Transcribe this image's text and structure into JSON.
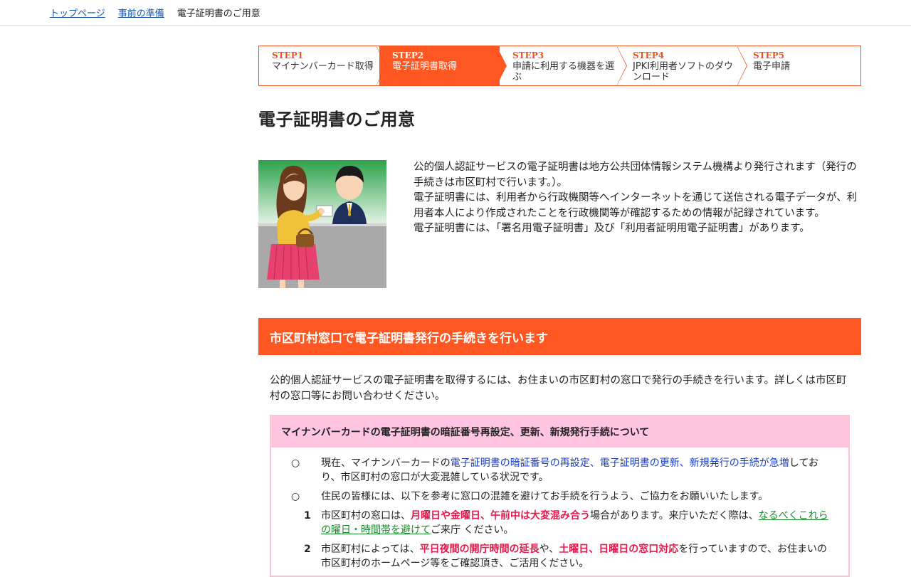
{
  "breadcrumb": {
    "home": "トップページ",
    "prep": "事前の準備",
    "current": "電子証明書のご用意"
  },
  "steps": [
    {
      "num": "STEP1",
      "label": "マイナンバーカード取得"
    },
    {
      "num": "STEP2",
      "label": "電子証明書取得"
    },
    {
      "num": "STEP3",
      "label": "申請に利用する機器を選ぶ"
    },
    {
      "num": "STEP4",
      "label": "JPKI利用者ソフトのダウンロード"
    },
    {
      "num": "STEP5",
      "label": "電子申請"
    }
  ],
  "active_step": 2,
  "title": "電子証明書のご用意",
  "intro": {
    "p1": "公的個人認証サービスの電子証明書は地方公共団体情報システム機構より発行されます（発行の手続きは市区町村で行います。）。",
    "p2": "電子証明書には、利用者から行政機関等へインターネットを通じて送信される電子データが、利用者本人により作成されたことを行政機関等が確認するための情報が記録されています。",
    "p3": "電子証明書には、「署名用電子証明書」及び「利用者証明用電子証明書」があります。"
  },
  "section": {
    "heading": "市区町村窓口で電子証明書発行の手続きを行います",
    "text": "公的個人認証サービスの電子証明書を取得するには、お住まいの市区町村の窓口で発行の手続きを行います。詳しくは市区町村の窓口等にお問い合わせください。"
  },
  "notice": {
    "heading": "マイナンバーカードの電子証明書の暗証番号再設定、更新、新規発行手続について",
    "item1_mark": "○",
    "item1_pre": "現在、マイナンバーカードの",
    "item1_blue": "電子証明書の暗証番号の再設定、電子証明書の更新、新規発行の手続が急増",
    "item1_post": "しており、市区町村の窓口が大変混雑している状況です。",
    "item2_mark": "○",
    "item2": "住民の皆様には、以下を参考に窓口の混雑を避けてお手続を行うよう、ご協力をお願いいたします。",
    "sub1_num": "1",
    "sub1_pre": "市区町村の窓口は、",
    "sub1_red": "月曜日や金曜日、午前中は大変混み合う",
    "sub1_mid": "場合があります。来庁いただく際は、",
    "sub1_link": "なるべくこれらの曜日・時間帯を避けて",
    "sub1_post": "ご来庁 ください。",
    "sub2_num": "2",
    "sub2_pre": "市区町村によっては、",
    "sub2_red1": "平日夜間の開庁時間の延長",
    "sub2_mid": "や、",
    "sub2_red2": "土曜日、日曜日の窓口対応",
    "sub2_post": "を行っていますので、お住まいの市区町村のホームページ等をご確認頂き、ご活用ください。"
  },
  "colors": {
    "accent": "#ff5722",
    "notice_bg": "#ffc4df",
    "link": "#1a55a8"
  }
}
